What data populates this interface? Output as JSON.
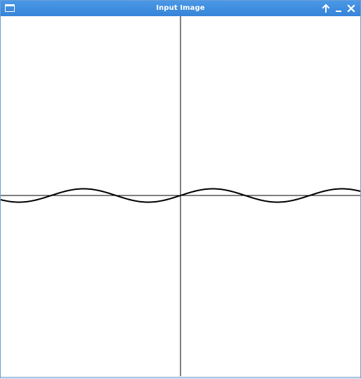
{
  "window": {
    "title": "Input Image",
    "icon": "window-icon",
    "controls": [
      "up-arrow-icon",
      "minimize-icon",
      "close-icon"
    ]
  },
  "plot": {
    "curve_color": "#000000",
    "axis_color": "#000000",
    "background": "#ffffff"
  }
}
